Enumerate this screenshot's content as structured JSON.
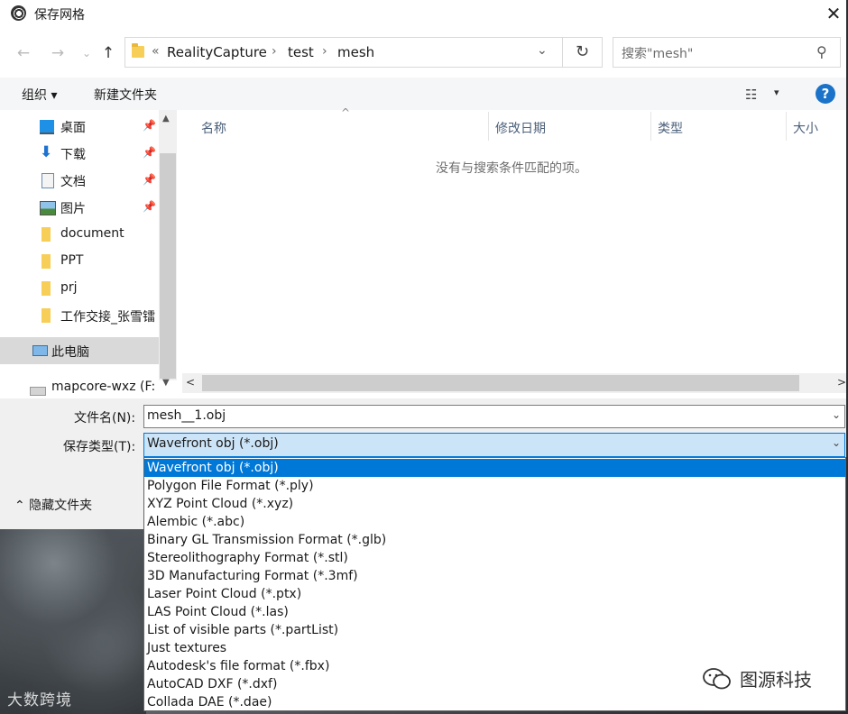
{
  "window": {
    "title": "保存网格",
    "close": "✕"
  },
  "nav": {
    "back": "←",
    "forward": "→",
    "recent": "⌄",
    "up": "↑",
    "breadcrumb_prefix": "«",
    "breadcrumb": [
      "RealityCapture",
      "test",
      "mesh"
    ],
    "breadcrumb_sep": "›",
    "address_dropdown": "⌄",
    "refresh": "↻",
    "search_placeholder": "搜索\"mesh\"",
    "search_icon": "⚲"
  },
  "toolbar": {
    "organize": "组织 ▾",
    "new_folder": "新建文件夹",
    "view_icon": "☷",
    "view_drop": "▾",
    "help": "?"
  },
  "sidebar": {
    "items": [
      {
        "label": "桌面",
        "icon": "desktop-icon",
        "pinned": true
      },
      {
        "label": "下载",
        "icon": "download-icon",
        "pinned": true
      },
      {
        "label": "文档",
        "icon": "document-icon",
        "pinned": true
      },
      {
        "label": "图片",
        "icon": "pictures-icon",
        "pinned": true
      },
      {
        "label": "document",
        "icon": "folder-icon",
        "pinned": false
      },
      {
        "label": "PPT",
        "icon": "folder-icon",
        "pinned": false
      },
      {
        "label": "prj",
        "icon": "folder-icon",
        "pinned": false
      },
      {
        "label": "工作交接_张雪镭",
        "icon": "folder-icon",
        "pinned": false
      },
      {
        "label": "此电脑",
        "icon": "computer-icon",
        "pinned": false
      }
    ],
    "pin_glyph": "📌",
    "drive_label": "mapcore-wxz (F:",
    "scroll_up": "▲",
    "scroll_down": "▼"
  },
  "file_list": {
    "columns": [
      "名称",
      "修改日期",
      "类型",
      "大小"
    ],
    "sort_arrow": "^",
    "empty_message": "没有与搜索条件匹配的项。",
    "hscroll_left": "<",
    "hscroll_right": ">"
  },
  "form": {
    "filename_label": "文件名(N):",
    "filename_value": "mesh__1.obj",
    "filetype_label": "保存类型(T):",
    "filetype_value": "Wavefront obj (*.obj)",
    "dropdown_arrow": "⌄",
    "hide_folders": "⌃  隐藏文件夹"
  },
  "filetype_options": [
    "Wavefront obj (*.obj)",
    "Polygon File Format (*.ply)",
    "XYZ Point Cloud (*.xyz)",
    "Alembic (*.abc)",
    "Binary GL Transmission Format (*.glb)",
    "Stereolithography Format (*.stl)",
    "3D Manufacturing Format (*.3mf)",
    "Laser Point Cloud (*.ptx)",
    "LAS Point Cloud (*.las)",
    "List of visible parts (*.partList)",
    "Just textures",
    "Autodesk's file format (*.fbx)",
    "AutoCAD DXF (*.dxf)",
    "Collada DAE (*.dae)"
  ],
  "watermarks": {
    "left": "大数跨境",
    "right": "图源科技"
  }
}
